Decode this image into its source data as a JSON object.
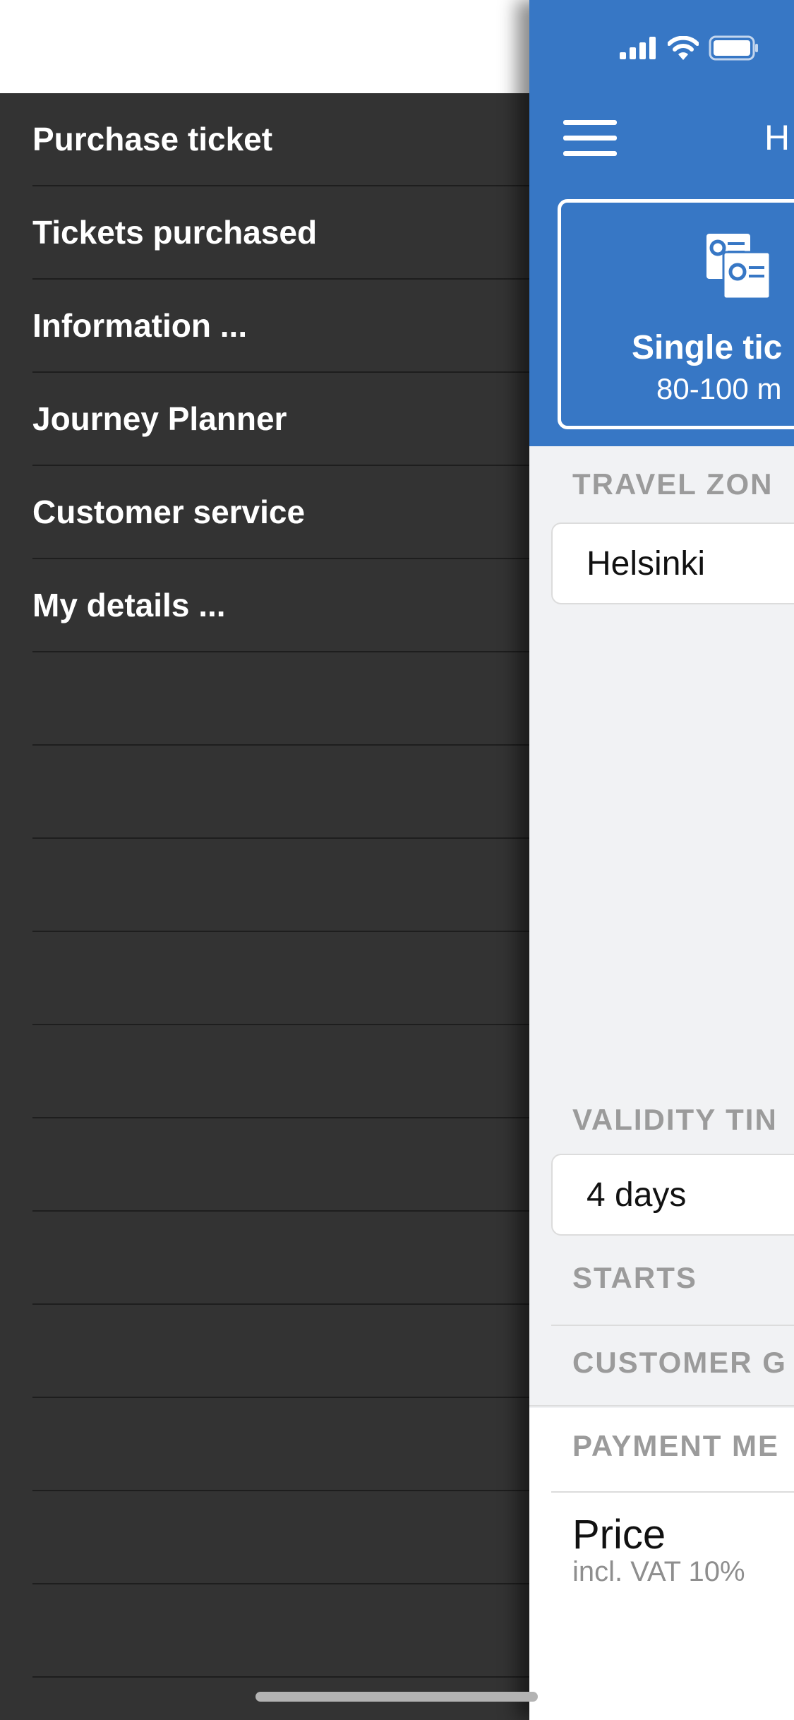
{
  "drawer": {
    "items": [
      {
        "label": "Purchase ticket"
      },
      {
        "label": "Tickets purchased"
      },
      {
        "label": "Information ..."
      },
      {
        "label": "Journey Planner"
      },
      {
        "label": "Customer service"
      },
      {
        "label": "My details ..."
      }
    ]
  },
  "header": {
    "title": "H",
    "menu_icon": "hamburger-icon"
  },
  "status_bar": {
    "icons": [
      "signal-icon",
      "wifi-icon",
      "battery-icon"
    ]
  },
  "ticket": {
    "title": "Single tic",
    "subtitle": "80-100 m",
    "icon": "ticket-settings-icon"
  },
  "travel_zone": {
    "label": "TRAVEL ZON",
    "value": "Helsinki"
  },
  "validity": {
    "label": "VALIDITY TIN",
    "value": "4 days"
  },
  "starts": {
    "label": "STARTS"
  },
  "customer": {
    "label": "CUSTOMER G"
  },
  "payment": {
    "label": "PAYMENT ME"
  },
  "price": {
    "label": "Price",
    "vat": "incl. VAT 10%"
  },
  "colors": {
    "brand_blue": "#3777c5",
    "drawer_bg": "#333333",
    "panel_bg": "#f1f2f4"
  }
}
